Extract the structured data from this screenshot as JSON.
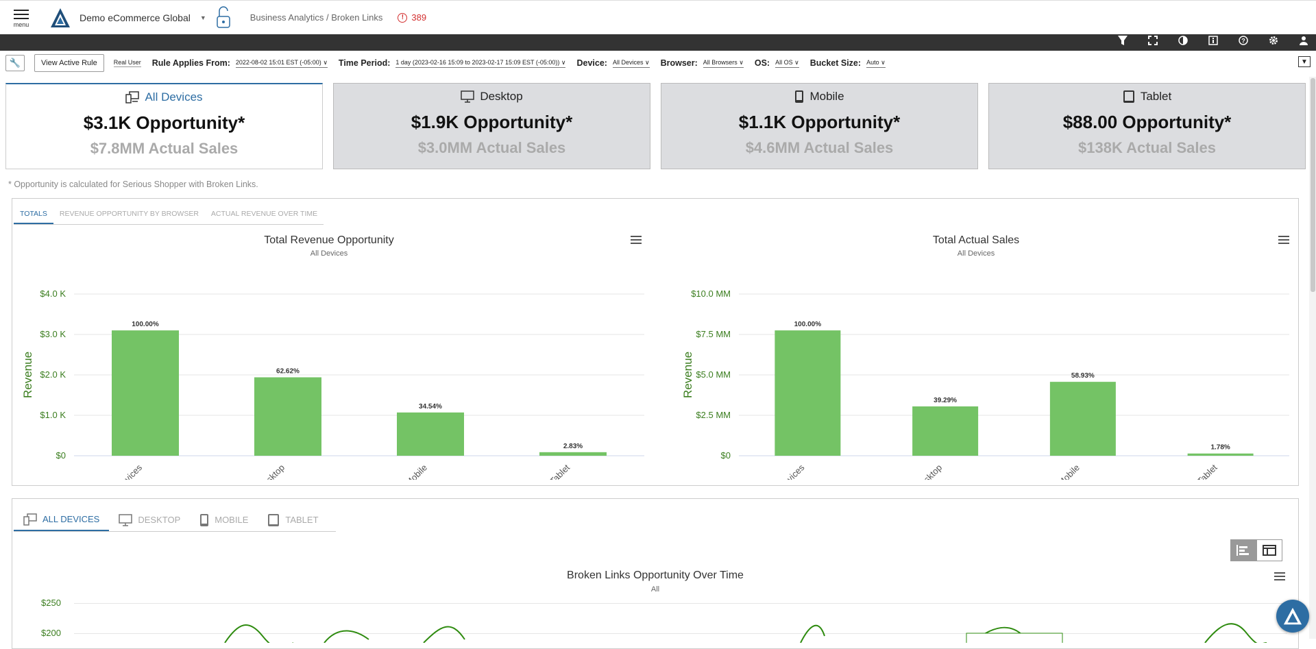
{
  "header": {
    "menu_label": "menu",
    "org_name": "Demo eCommerce Global",
    "breadcrumb": "Business Analytics / Broken Links",
    "alert_count": "389"
  },
  "filters": {
    "view_rule": "View Active Rule",
    "real_user": "Real User",
    "rule_from_label": "Rule Applies From:",
    "rule_from_value": "2022-08-02 15:01 EST (-05:00)",
    "period_label": "Time Period:",
    "period_value": "1 day (2023-02-16 15:09 to 2023-02-17 15:09 EST (-05:00))",
    "device_label": "Device:",
    "device_value": "All Devices",
    "browser_label": "Browser:",
    "browser_value": "All Browsers",
    "os_label": "OS:",
    "os_value": "All OS",
    "bucket_label": "Bucket Size:",
    "bucket_value": "Auto"
  },
  "cards": [
    {
      "title": "All Devices",
      "opportunity": "$3.1K Opportunity*",
      "sales": "$7.8MM Actual Sales"
    },
    {
      "title": "Desktop",
      "opportunity": "$1.9K Opportunity*",
      "sales": "$3.0MM Actual Sales"
    },
    {
      "title": "Mobile",
      "opportunity": "$1.1K Opportunity*",
      "sales": "$4.6MM Actual Sales"
    },
    {
      "title": "Tablet",
      "opportunity": "$88.00 Opportunity*",
      "sales": "$138K Actual Sales"
    }
  ],
  "footnote": "* Opportunity is calculated for Serious Shopper with Broken Links.",
  "panel_tabs": [
    "TOTALS",
    "REVENUE OPPORTUNITY BY BROWSER",
    "ACTUAL REVENUE OVER TIME"
  ],
  "device_tabs": [
    "ALL DEVICES",
    "DESKTOP",
    "MOBILE",
    "TABLET"
  ],
  "over_time": {
    "title": "Broken Links Opportunity Over Time",
    "subtitle": "All",
    "ytick_labels": [
      "$250",
      "$200"
    ]
  },
  "colors": {
    "bar": "#74c365",
    "accent": "#2d6da3",
    "axis_text": "#3a7d1e",
    "alert": "#d32f2f"
  },
  "chart_data": [
    {
      "type": "bar",
      "title": "Total Revenue Opportunity",
      "subtitle": "All Devices",
      "ylabel": "Revenue",
      "categories": [
        "All Devices",
        "Desktop",
        "Mobile",
        "Tablet"
      ],
      "values": [
        3100,
        1940,
        1070,
        88
      ],
      "data_labels": [
        "100.00%",
        "62.62%",
        "34.54%",
        "2.83%"
      ],
      "ylim": [
        0,
        4000
      ],
      "yticks": [
        0,
        1000,
        2000,
        3000,
        4000
      ],
      "ytick_labels": [
        "$0",
        "$1.0 K",
        "$2.0 K",
        "$3.0 K",
        "$4.0 K"
      ]
    },
    {
      "type": "bar",
      "title": "Total Actual Sales",
      "subtitle": "All Devices",
      "ylabel": "Revenue",
      "categories": [
        "All Devices",
        "Desktop",
        "Mobile",
        "Tablet"
      ],
      "values": [
        7750000,
        3050000,
        4570000,
        138000
      ],
      "data_labels": [
        "100.00%",
        "39.29%",
        "58.93%",
        "1.78%"
      ],
      "ylim": [
        0,
        10000000
      ],
      "yticks": [
        0,
        2500000,
        5000000,
        7500000,
        10000000
      ],
      "ytick_labels": [
        "$0",
        "$2.5 MM",
        "$5.0 MM",
        "$7.5 MM",
        "$10.0 MM"
      ]
    }
  ]
}
